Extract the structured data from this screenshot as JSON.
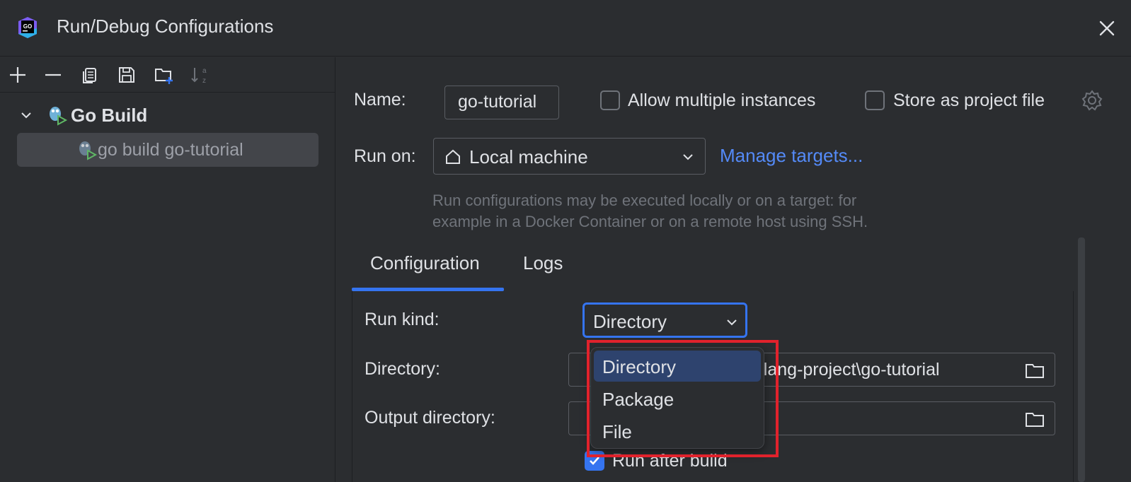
{
  "window": {
    "title": "Run/Debug Configurations",
    "logo_text": "GO"
  },
  "toolbar": {
    "buttons": [
      "add-icon",
      "remove-icon",
      "copy-icon",
      "save-icon",
      "new-folder-icon",
      "sort-icon"
    ]
  },
  "tree": {
    "group_label": "Go Build",
    "items": [
      {
        "label": "go build go-tutorial",
        "selected": true
      }
    ]
  },
  "form": {
    "name_label": "Name:",
    "name_value": "go-tutorial",
    "allow_multiple_label": "Allow multiple instances",
    "allow_multiple_checked": false,
    "store_project_label": "Store as project file",
    "store_project_checked": false,
    "run_on_label": "Run on:",
    "run_on_value": "Local machine",
    "manage_targets_link": "Manage targets...",
    "hint_line1": "Run configurations may be executed locally or on a target: for",
    "hint_line2": "example in a Docker Container or on a remote host using SSH."
  },
  "tabs": [
    {
      "label": "Configuration",
      "active": true
    },
    {
      "label": "Logs",
      "active": false
    }
  ],
  "config": {
    "run_kind_label": "Run kind:",
    "run_kind_value": "Directory",
    "directory_label": "Directory:",
    "directory_value": "golang-project\\go-tutorial",
    "output_directory_label": "Output directory:",
    "output_directory_value": "",
    "run_after_build_label": "Run after build",
    "run_after_build_checked": true
  },
  "dropdown": {
    "options": [
      {
        "label": "Directory",
        "selected": true
      },
      {
        "label": "Package",
        "selected": false
      },
      {
        "label": "File",
        "selected": false
      }
    ]
  },
  "colors": {
    "background": "#2b2d30",
    "accent": "#3574f0",
    "link": "#548af7",
    "highlight_box": "#e1222c",
    "selection": "#2e436e"
  }
}
